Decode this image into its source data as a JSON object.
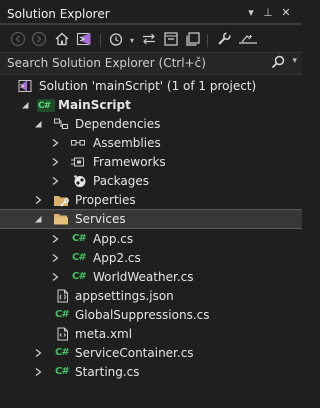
{
  "window": {
    "title": "Solution Explorer",
    "controls": {
      "dropdown": "▾",
      "pin": "⊥",
      "close": "✕"
    }
  },
  "toolbar": {
    "icons": [
      "back-icon",
      "forward-icon",
      "home-icon",
      "vs-icon",
      "history-icon",
      "sync-icon",
      "collapse-icon",
      "copy-icon",
      "properties-icon",
      "preview-icon"
    ]
  },
  "search": {
    "placeholder": "Search Solution Explorer (Ctrl+č)"
  },
  "tree": {
    "solution": "Solution 'mainScript' (1 of 1 project)",
    "project": "MainScript",
    "dependencies": "Dependencies",
    "assemblies": "Assemblies",
    "frameworks": "Frameworks",
    "packages": "Packages",
    "properties": "Properties",
    "services": "Services",
    "app_cs": "App.cs",
    "app2_cs": "App2.cs",
    "worldweather_cs": "WorldWeather.cs",
    "appsettings": "appsettings.json",
    "globalsuppressions": "GlobalSuppressions.cs",
    "meta": "meta.xml",
    "servicecontainer": "ServiceContainer.cs",
    "starting": "Starting.cs",
    "cs_badge": "C#"
  },
  "colors": {
    "background": "#1f1f1f",
    "selection": "#373737",
    "csharp_green": "#3fc160",
    "folder": "#d8b26a"
  }
}
